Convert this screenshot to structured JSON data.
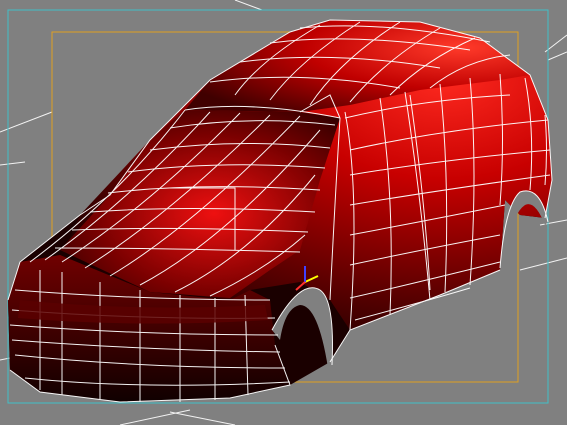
{
  "viewport": {
    "background_color": "#808080",
    "model": {
      "object": "car-body",
      "display_mode": "smooth-shaded-with-wireframe",
      "material_color": "#d40000",
      "highlight_color": "#ff2a20",
      "shadow_color": "#1a0000",
      "wire_color": "#ffffff"
    },
    "safe_frame": {
      "inner_color": "#e0a020",
      "outer_color": "#40c0c8"
    },
    "grid_line_color": "#ffffff",
    "transform_gizmo": {
      "icon": "axis-tripod-icon",
      "colors": [
        "#ffff00",
        "#4040ff",
        "#ff3030"
      ]
    }
  }
}
